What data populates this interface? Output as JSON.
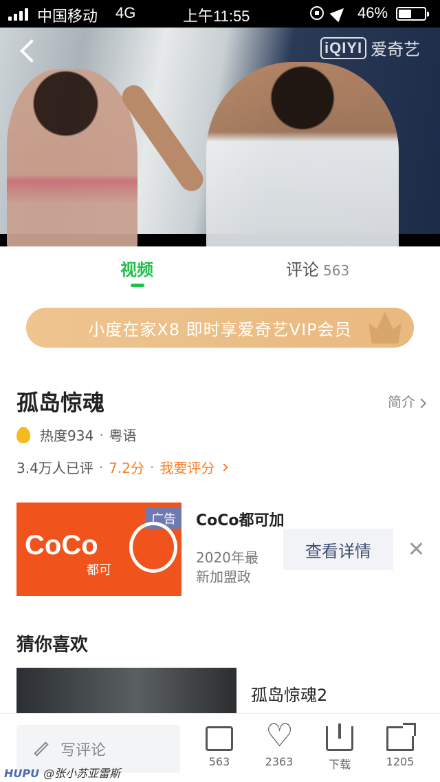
{
  "status_bar": {
    "carrier": "中国移动",
    "network": "4G",
    "time": "上午11:55",
    "battery": "46%"
  },
  "player": {
    "logo_text": "iQIYI",
    "logo_brand": "爱奇艺"
  },
  "tabs": [
    {
      "label": "视频",
      "active": true
    },
    {
      "label": "评论",
      "count": "563"
    }
  ],
  "promo": {
    "text": "小度在家X8 即时享爱奇艺VIP会员"
  },
  "show": {
    "title": "孤岛惊魂",
    "intro_label": "简介",
    "heat": "热度934",
    "language": "粤语",
    "rated_count": "3.4万人已评",
    "score": "7.2分",
    "rate_link": "我要评分"
  },
  "ad": {
    "badge": "广告",
    "logo": "CoCo",
    "logo_sub": "都可",
    "title": "CoCo都可加",
    "desc": "2020年最新加盟政",
    "button": "查看详情"
  },
  "recommend": {
    "heading": "猜你喜欢",
    "items": [
      {
        "title": "孤岛惊魂2"
      }
    ]
  },
  "bottom_bar": {
    "comment_placeholder": "写评论",
    "comments": "563",
    "likes": "2363",
    "download": "下载",
    "shares": "1205"
  },
  "watermark": {
    "site": "HUPU",
    "user": "@张小苏亚雷斯"
  },
  "colors": {
    "accent_green": "#1fbf4a",
    "accent_orange": "#ff7a20",
    "promo_gold": "#eec48f",
    "ad_orange": "#f0531c"
  }
}
